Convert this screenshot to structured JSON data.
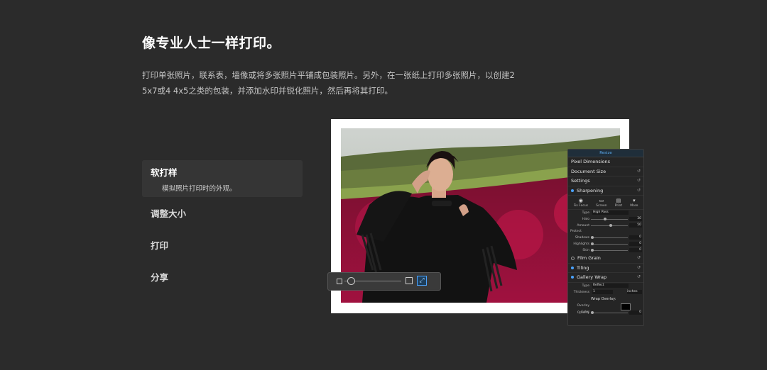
{
  "heading": "像专业人士一样打印。",
  "description": {
    "line1": "打印单张照片，联系表，墙像或将多张照片平铺成包装照片。另外，在一张纸上打印多张照片，以创建2",
    "line2": "5x7或4 4x5之类的包装，并添加水印并锐化照片，然后再将其打印。"
  },
  "menu": {
    "active": {
      "label": "软打样",
      "sub": "模拟照片打印时的外观。"
    },
    "items": [
      "调整大小",
      "打印",
      "分享"
    ]
  },
  "panel": {
    "tab": "Resize",
    "pixel_dimensions": "Pixel Dimensions",
    "document_size": "Document Size",
    "settings": "Settings",
    "sharpening": "Sharpening",
    "presets": [
      "Fix Focus",
      "Screen",
      "Print",
      "More"
    ],
    "type_label": "Type",
    "type_value": "High Pass",
    "halo_label": "Halo",
    "halo_value": "30",
    "halo_level": 0.35,
    "amount_label": "Amount",
    "amount_value": "50",
    "amount_level": 0.5,
    "protect": "Protect",
    "shadows_label": "Shadows",
    "shadows_value": "0",
    "highlights_label": "Highlights",
    "highlights_value": "0",
    "skin_label": "Skin",
    "skin_value": "0",
    "film_grain": "Film Grain",
    "tiling": "Tiling",
    "gallery_wrap": "Gallery Wrap",
    "gw_type_label": "Type",
    "gw_type_value": "Reflect",
    "thickness_label": "Thickness",
    "thickness_value": "1",
    "thickness_unit": "inches",
    "wrap_overlay": "Wrap Overlay:",
    "overlay_color": "Overlay Color",
    "opacity_label": "Opacity",
    "opacity_value": "0",
    "reset_glyph": "↺"
  },
  "zoom_fit_glyph": "⤢",
  "colors": {
    "accent": "#4aa3ff",
    "background": "#2b2b2b"
  }
}
